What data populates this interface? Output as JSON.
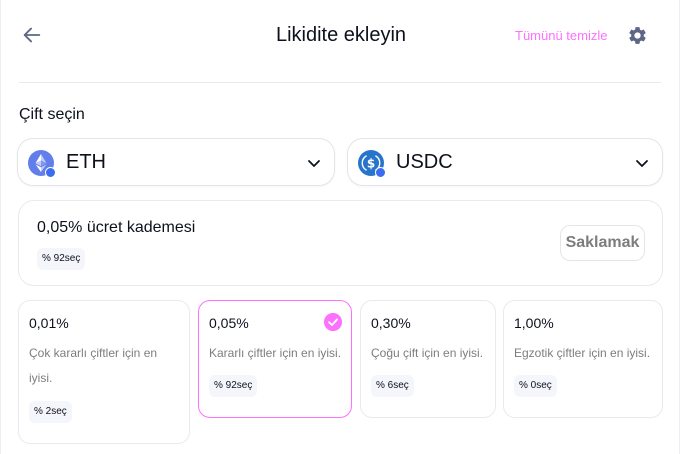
{
  "header": {
    "title": "Likidite ekleyin",
    "clear_all": "Tümünü temizle",
    "back_icon": "arrow-left-icon",
    "settings_icon": "gear-icon"
  },
  "pair": {
    "label": "Çift seçin",
    "token_a": {
      "symbol": "ETH",
      "icon": "eth-icon",
      "color": "#627eea"
    },
    "token_b": {
      "symbol": "USDC",
      "icon": "usdc-icon",
      "color": "#2775ca"
    }
  },
  "fee_tier": {
    "title": "0,05% ücret kademesi",
    "selection_badge": "% 92seç",
    "hide_label": "Saklamak"
  },
  "tiers": [
    {
      "percent": "0,01%",
      "description": "Çok kararlı çiftler için en iyisi.",
      "badge": "% 2seç",
      "selected": false
    },
    {
      "percent": "0,05%",
      "description": "Kararlı çiftler için en iyisi.",
      "badge": "% 92seç",
      "selected": true
    },
    {
      "percent": "0,30%",
      "description": "Çoğu çift için en iyisi.",
      "badge": "% 6seç",
      "selected": false
    },
    {
      "percent": "1,00%",
      "description": "Egzotik çiftler için en iyisi.",
      "badge": "% 0seç",
      "selected": false
    }
  ],
  "colors": {
    "accent": "#fc72ff",
    "text_primary": "#0d111c",
    "text_secondary": "#7d7d7d",
    "border": "#e8eaef"
  }
}
